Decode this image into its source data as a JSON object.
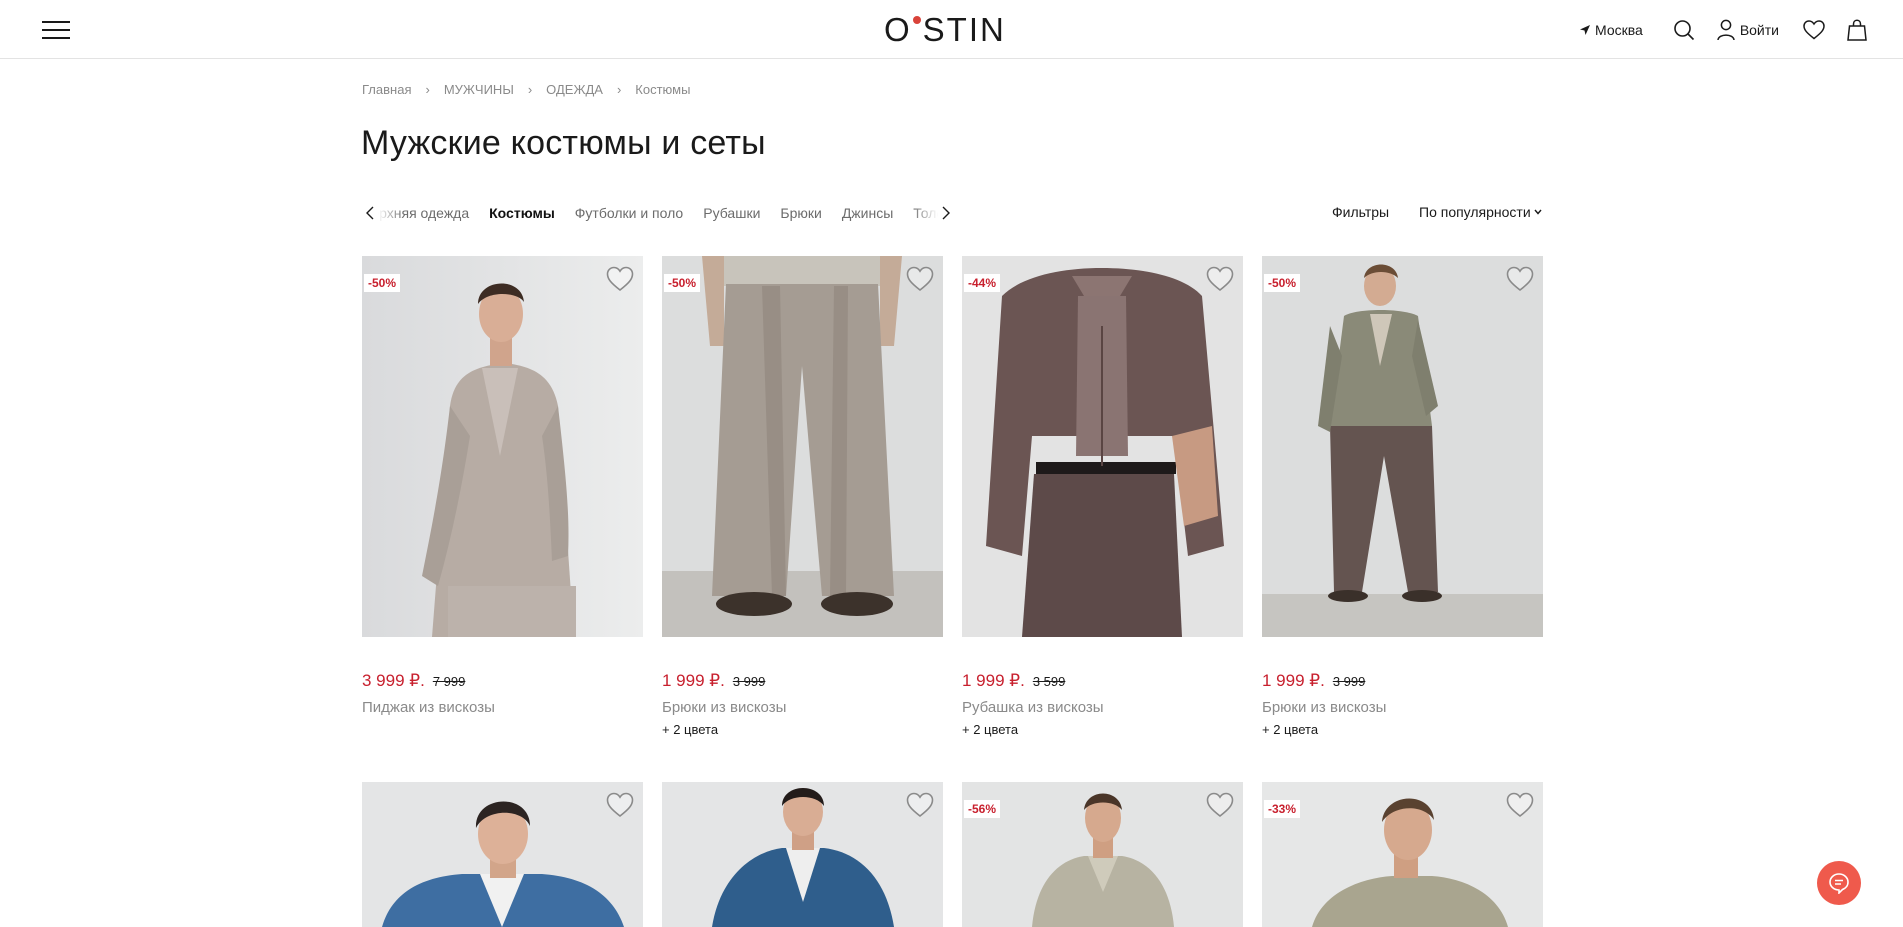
{
  "header": {
    "logo_left": "O",
    "logo_right": "STIN",
    "location": "Москва",
    "login": "Войти"
  },
  "breadcrumbs": [
    "Главная",
    "МУЖЧИНЫ",
    "ОДЕЖДА",
    "Костюмы"
  ],
  "page_title": "Мужские костюмы и сеты",
  "categories": [
    {
      "label": "Верхняя одежда",
      "active": false
    },
    {
      "label": "Костюмы",
      "active": true
    },
    {
      "label": "Футболки и поло",
      "active": false
    },
    {
      "label": "Рубашки",
      "active": false
    },
    {
      "label": "Брюки",
      "active": false
    },
    {
      "label": "Джинсы",
      "active": false
    },
    {
      "label": "Толстовки",
      "active": false
    }
  ],
  "toolbar": {
    "filters": "Фильтры",
    "sort": "По популярности"
  },
  "products": [
    {
      "badge": "-50%",
      "price": "3 999 ₽.",
      "old_price": "7 999",
      "name": "Пиджак из вискозы",
      "colors": ""
    },
    {
      "badge": "-50%",
      "price": "1 999 ₽.",
      "old_price": "3 999",
      "name": "Брюки из вискозы",
      "colors": "+ 2 цвета"
    },
    {
      "badge": "-44%",
      "price": "1 999 ₽.",
      "old_price": "3 599",
      "name": "Рубашка из вискозы",
      "colors": "+ 2 цвета"
    },
    {
      "badge": "-50%",
      "price": "1 999 ₽.",
      "old_price": "3 999",
      "name": "Брюки из вискозы",
      "colors": "+ 2 цвета"
    }
  ],
  "products_row2": [
    {
      "badge": ""
    },
    {
      "badge": ""
    },
    {
      "badge": "-56%"
    },
    {
      "badge": "-33%"
    }
  ],
  "colors": {
    "sale_red": "#c8202e",
    "chat_button": "#ef5a4c",
    "logo_dot": "#d9433a"
  }
}
